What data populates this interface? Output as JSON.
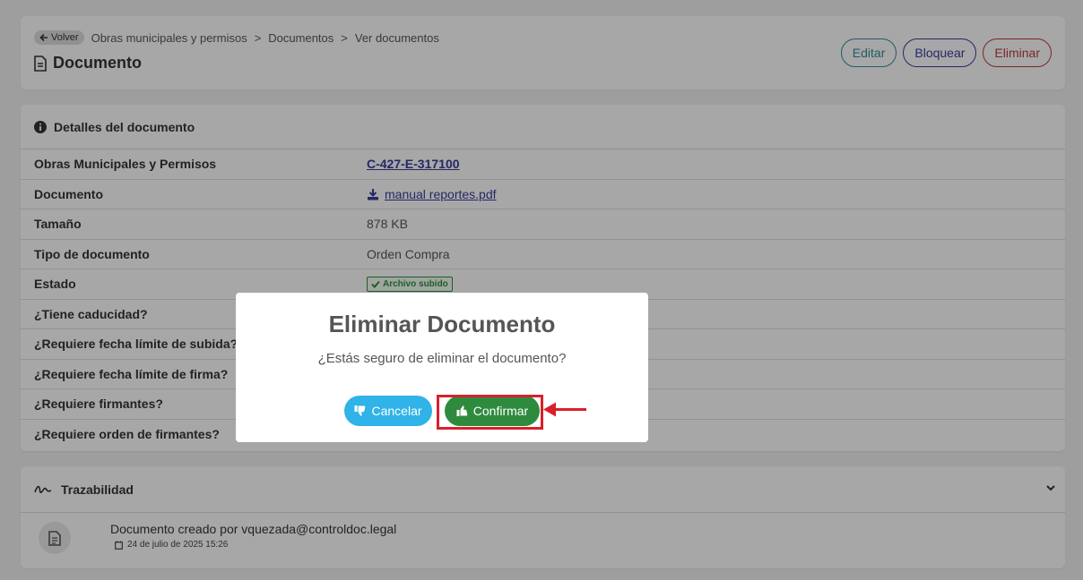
{
  "header": {
    "back_label": "Volver",
    "breadcrumb": [
      "Obras municipales y permisos",
      "Documentos",
      "Ver documentos"
    ],
    "separator": ">",
    "title": "Documento",
    "actions": {
      "edit": "Editar",
      "block": "Bloquear",
      "delete": "Eliminar"
    }
  },
  "details": {
    "title": "Detalles del documento",
    "rows": [
      {
        "label": "Obras Municipales y Permisos",
        "value": "C-427-E-317100"
      },
      {
        "label": "Documento",
        "value": "manual reportes.pdf"
      },
      {
        "label": "Tamaño",
        "value": "878 KB"
      },
      {
        "label": "Tipo de documento",
        "value": "Orden Compra"
      },
      {
        "label": "Estado",
        "value": "Archivo subido"
      },
      {
        "label": "¿Tiene caducidad?",
        "value": ""
      },
      {
        "label": "¿Requiere fecha límite de subida?",
        "value": ""
      },
      {
        "label": "¿Requiere fecha límite de firma?",
        "value": ""
      },
      {
        "label": "¿Requiere firmantes?",
        "value": ""
      },
      {
        "label": "¿Requiere orden de firmantes?",
        "value": ""
      }
    ]
  },
  "trace": {
    "title": "Trazabilidad",
    "items": [
      {
        "text": "Documento creado por vquezada@controldoc.legal",
        "date": "24 de julio de 2025 15:26"
      }
    ]
  },
  "modal": {
    "title": "Eliminar Documento",
    "message": "¿Estás seguro de eliminar el documento?",
    "cancel_label": "Cancelar",
    "confirm_label": "Confirmar"
  },
  "colors": {
    "confirm": "#2e8b3e",
    "cancel": "#2fb3e8",
    "highlight": "#d9202a",
    "link": "#3b3b9a"
  }
}
